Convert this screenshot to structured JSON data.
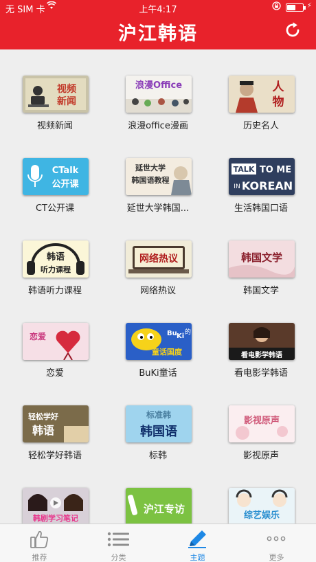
{
  "status_bar": {
    "carrier": "无 SIM 卡",
    "time": "上午4:17",
    "battery_level": 0.55
  },
  "header": {
    "title": "沪江韩语",
    "refresh_icon": "refresh-icon"
  },
  "topics": [
    {
      "label": "视频新闻",
      "thumb_text": [
        "视频",
        "新闻"
      ]
    },
    {
      "label": "浪漫office漫画",
      "thumb_text": [
        "浪漫Office"
      ]
    },
    {
      "label": "历史名人",
      "thumb_text": [
        "人",
        "物"
      ]
    },
    {
      "label": "CT公开课",
      "thumb_text": [
        "CTalk",
        "公开课"
      ]
    },
    {
      "label": "延世大学韩国...",
      "thumb_text": [
        "延世大学",
        "韩国语教程"
      ]
    },
    {
      "label": "生活韩国口语",
      "thumb_text": [
        "TALK",
        "TO ME",
        "IN",
        "KOREAN"
      ]
    },
    {
      "label": "韩语听力课程",
      "thumb_text": [
        "韩语",
        "听力课程"
      ]
    },
    {
      "label": "网络热议",
      "thumb_text": [
        "网络热议"
      ]
    },
    {
      "label": "韩国文学",
      "thumb_text": [
        "韩国文学"
      ]
    },
    {
      "label": "恋爱",
      "thumb_text": [
        "恋爱"
      ]
    },
    {
      "label": "BuKi童话",
      "thumb_text": [
        "Bu",
        "Ki",
        "的",
        "童话国度"
      ]
    },
    {
      "label": "看电影学韩语",
      "thumb_text": [
        "看电影学韩语"
      ]
    },
    {
      "label": "轻松学好韩语",
      "thumb_text": [
        "轻松学好",
        "韩语"
      ]
    },
    {
      "label": "标韩",
      "thumb_text": [
        "标准韩",
        "韩国语"
      ]
    },
    {
      "label": "影视原声",
      "thumb_text": [
        "影视原声"
      ]
    },
    {
      "label": "",
      "thumb_text": [
        "韩剧学习笔记"
      ]
    },
    {
      "label": "",
      "thumb_text": [
        "沪江专访"
      ]
    },
    {
      "label": "",
      "thumb_text": [
        "综艺娱乐"
      ]
    }
  ],
  "tab_bar": {
    "tabs": [
      {
        "label": "推荐",
        "icon": "thumbs-up-icon"
      },
      {
        "label": "分类",
        "icon": "list-icon"
      },
      {
        "label": "主题",
        "icon": "pencil-icon",
        "active": true
      },
      {
        "label": "更多",
        "icon": "more-dots-icon"
      }
    ]
  }
}
